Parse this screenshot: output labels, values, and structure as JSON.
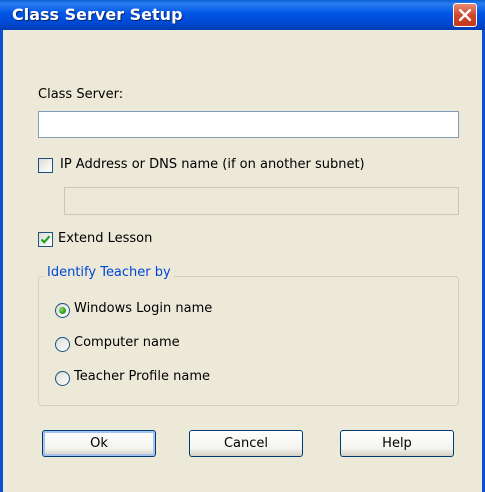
{
  "window": {
    "title": "Class Server Setup"
  },
  "class_server": {
    "label": "Class Server:",
    "value": ""
  },
  "ip_option": {
    "label": "IP Address or DNS name (if on another subnet)",
    "checked": false,
    "value": ""
  },
  "extend_lesson": {
    "label": "Extend Lesson",
    "checked": true
  },
  "identify_group": {
    "legend": "Identify Teacher by",
    "options": [
      {
        "label": "Windows Login name",
        "selected": true
      },
      {
        "label": "Computer name",
        "selected": false
      },
      {
        "label": "Teacher Profile name",
        "selected": false
      }
    ]
  },
  "buttons": {
    "ok": "Ok",
    "cancel": "Cancel",
    "help": "Help"
  },
  "colors": {
    "titlebar": "#0055e5",
    "accent": "#0046d5",
    "close": "#d0482a"
  }
}
